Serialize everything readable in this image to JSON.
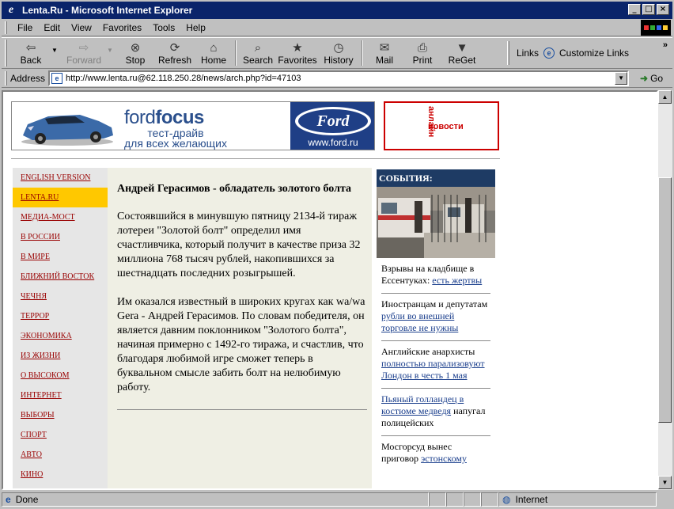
{
  "window": {
    "title": "Lenta.Ru - Microsoft Internet Explorer",
    "controls": [
      "_",
      "□",
      "×"
    ]
  },
  "menu": [
    "File",
    "Edit",
    "View",
    "Favorites",
    "Tools",
    "Help"
  ],
  "toolbar": {
    "back": "Back",
    "forward": "Forward",
    "stop": "Stop",
    "refresh": "Refresh",
    "home": "Home",
    "search": "Search",
    "favorites": "Favorites",
    "history": "History",
    "mail": "Mail",
    "print": "Print",
    "reget": "ReGet",
    "links": "Links",
    "customize_links": "Customize Links"
  },
  "address": {
    "label": "Address",
    "url": "http://www.lenta.ru@62.118.250.28/news/arch.php?id=47103",
    "go": "Go"
  },
  "banner": {
    "brand_bold": "focus",
    "brand_light": "ford",
    "line1": "тест-драйв",
    "line2": "для всех желающих",
    "logo": "Ford",
    "url": "www.ford.ru",
    "news": "новости",
    "news_diag": "анлайн"
  },
  "nav": [
    "ENGLISH VERSION",
    "LENTA.RU",
    "МЕДИА-МОСТ",
    "В РОССИИ",
    "В МИРЕ",
    "БЛИЖНИЙ ВОСТОК",
    "ЧЕЧНЯ",
    "ТЕРРОР",
    "ЭКОНОМИКА",
    "ИЗ ЖИЗНИ",
    "О ВЫСОКОМ",
    "ИНТЕРНЕТ",
    "ВЫБОРЫ",
    "СПОРТ",
    "АВТО",
    "КИНО"
  ],
  "article": {
    "title": "Андрей Герасимов - обладатель золотого болта",
    "p1": "Состоявшийся в минувшую пятницу 2134-й тираж лотереи \"Золотой болт\" определил имя счастливчика, который получит в качестве приза 32 миллиона 768 тысяч рублей, накопившихся за шестнадцать последних розыгрышей.",
    "p2": "Им оказался известный в широких кругах как wa/wa Gera - Андрей Герасимов. По словам победителя, он является давним поклонником \"Золотого болта\", начиная примерно с 1492-го тиража, и счастлив, что благодаря любимой игре сможет теперь в буквальном смысле забить болт на нелюбимую работу."
  },
  "events": {
    "header": "СОБЫТИЯ:",
    "items": [
      {
        "text": "Взрывы на кладбище в Ессентуках: ",
        "link": "есть жертвы"
      },
      {
        "text": "Иностранцам и депутатам ",
        "link": "рубли во внешней торговле не нужны"
      },
      {
        "text": "Английские анархисты ",
        "link": "полностью парализовуют Лондон в честь 1 мая"
      },
      {
        "text": " напугал полицейских",
        "link": "Пьяный голландец в костюме медведя"
      },
      {
        "text": "Мосгорсуд вынес приговор ",
        "link": "эстонскому"
      }
    ]
  },
  "status": {
    "text": "Done",
    "zone": "Internet"
  }
}
